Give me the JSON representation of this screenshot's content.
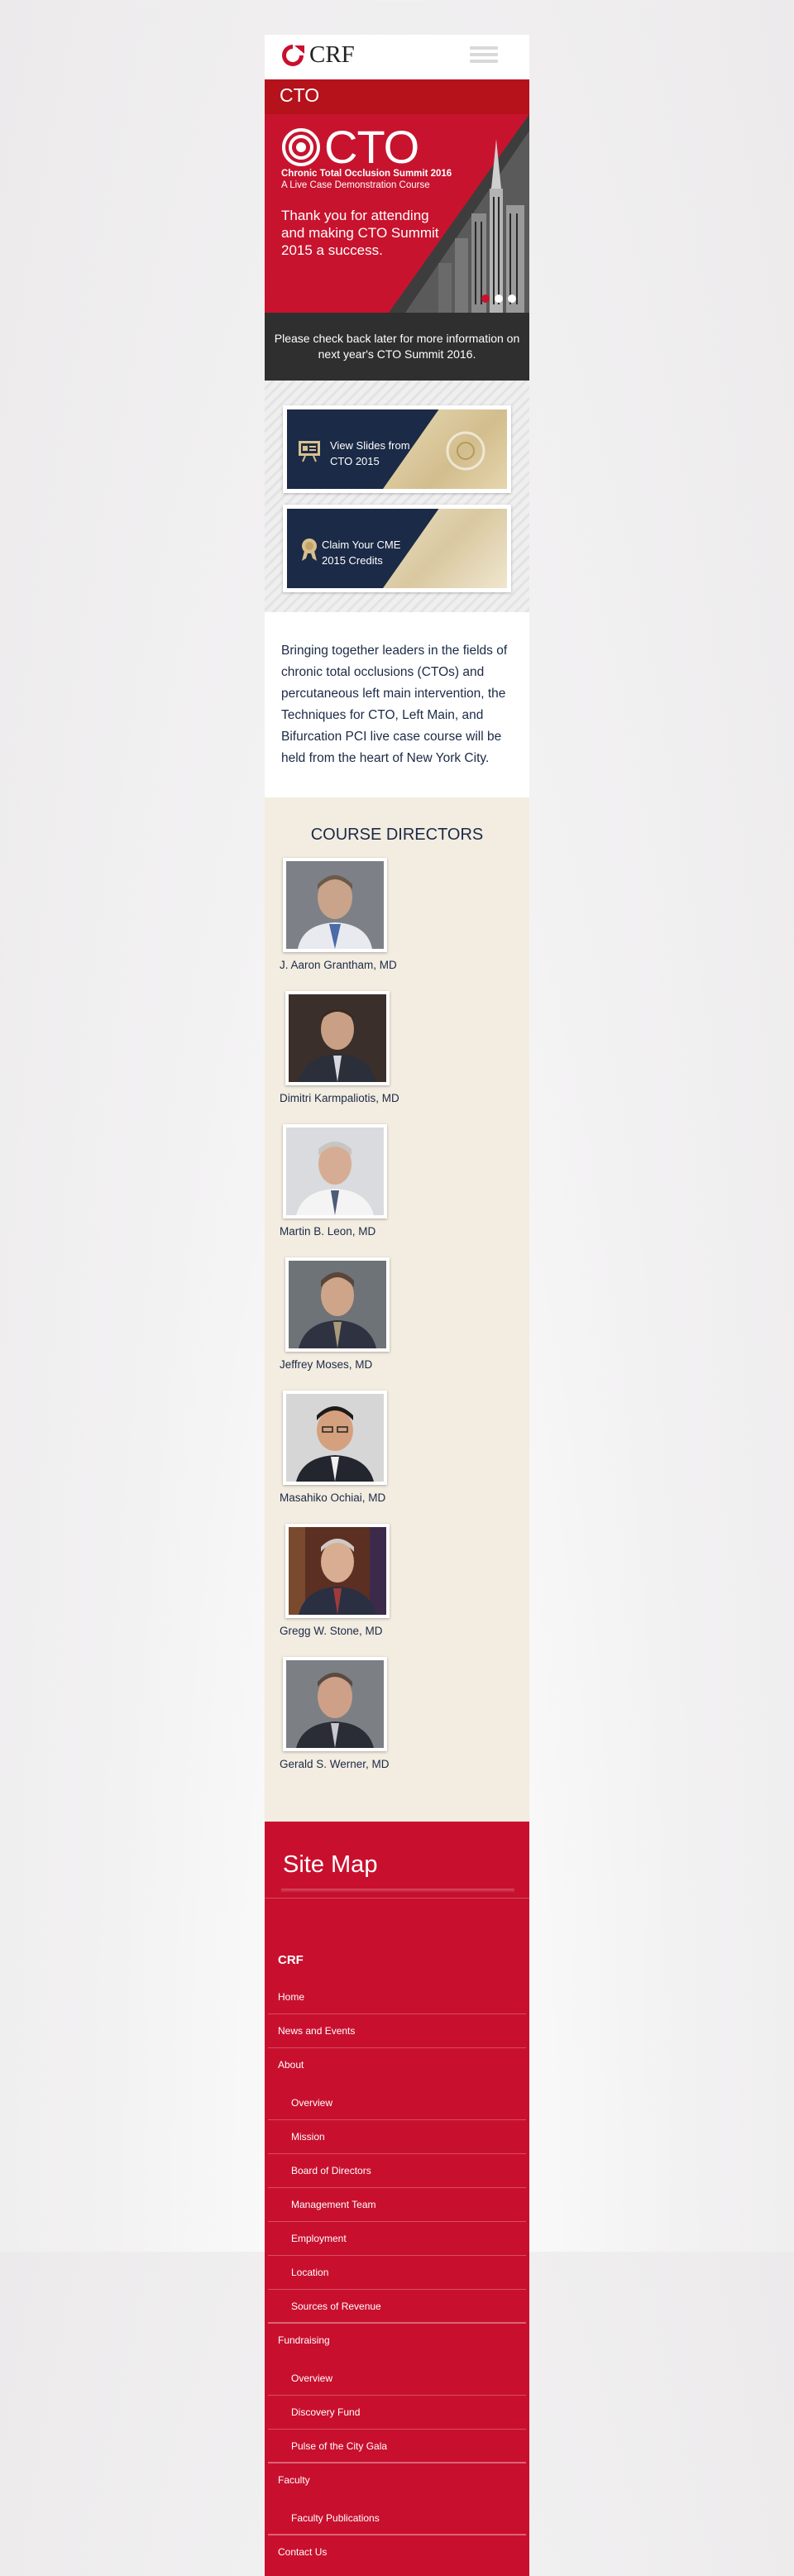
{
  "header": {
    "logo_text": "CRF",
    "menu_icon": "hamburger-menu-icon"
  },
  "section_title": "CTO",
  "hero": {
    "logo_text": "CTO",
    "subtitle_line1": "Chronic Total Occlusion Summit 2016",
    "subtitle_line2": "A Live Case Demonstration Course",
    "thanks": "Thank you for attending and making CTO Summit 2015 a success.",
    "note": "Please check back later for more information on next year's CTO Summit 2016.",
    "slide_count": 3,
    "active_slide": 1
  },
  "cards": [
    {
      "label": "View Slides from CTO 2015",
      "icon": "presentation-icon"
    },
    {
      "label": "Claim Your CME 2015 Credits",
      "icon": "award-ribbon-icon"
    }
  ],
  "intro": "Bringing together leaders in the fields of chronic total occlusions (CTOs) and percutaneous left main intervention, the Techniques for CTO, Left Main, and Bifurcation PCI live case course will be held from the heart of New York City.",
  "directors": {
    "heading": "COURSE DIRECTORS",
    "people": [
      {
        "name": "J. Aaron Grantham, MD"
      },
      {
        "name": "Dimitri Karmpaliotis, MD"
      },
      {
        "name": "Martin B. Leon, MD"
      },
      {
        "name": "Jeffrey Moses, MD"
      },
      {
        "name": "Masahiko Ochiai, MD"
      },
      {
        "name": "Gregg W. Stone, MD"
      },
      {
        "name": "Gerald S. Werner, MD"
      }
    ]
  },
  "sitemap": {
    "title": "Site Map",
    "group": "CRF",
    "items": [
      {
        "label": "Home",
        "level": 0
      },
      {
        "label": "News and Events",
        "level": 0
      },
      {
        "label": "About",
        "level": 0
      },
      {
        "label": "Overview",
        "level": 1
      },
      {
        "label": "Mission",
        "level": 1
      },
      {
        "label": "Board of Directors",
        "level": 1
      },
      {
        "label": "Management Team",
        "level": 1
      },
      {
        "label": "Employment",
        "level": 1
      },
      {
        "label": "Location",
        "level": 1
      },
      {
        "label": "Sources of Revenue",
        "level": 1
      },
      {
        "label": "Fundraising",
        "level": 0
      },
      {
        "label": "Overview",
        "level": 1
      },
      {
        "label": "Discovery Fund",
        "level": 1
      },
      {
        "label": "Pulse of the City Gala",
        "level": 1
      },
      {
        "label": "Faculty",
        "level": 0
      },
      {
        "label": "Faculty Publications",
        "level": 1
      },
      {
        "label": "Contact Us",
        "level": 0
      }
    ]
  },
  "colors": {
    "brand_red": "#c8102e",
    "dark_navy": "#1b2a46",
    "beige": "#f3ece1"
  }
}
